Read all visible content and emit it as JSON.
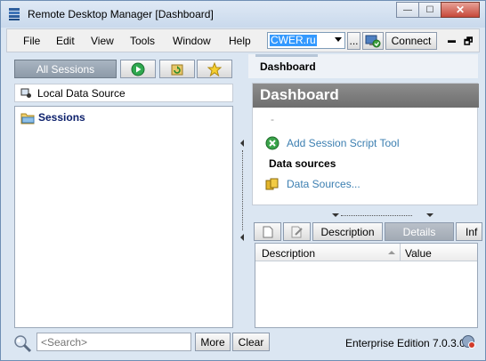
{
  "window": {
    "title": "Remote Desktop Manager [Dashboard]"
  },
  "window_controls": {
    "minimize": "—",
    "maximize": "☐",
    "close": "✕"
  },
  "menu": {
    "items": [
      "File",
      "Edit",
      "View",
      "Tools",
      "Window",
      "Help"
    ],
    "url_value": "CWER.ru",
    "more_label": "...",
    "connect_label": "Connect",
    "pin_glyph": "▬",
    "restore_glyph": "🗗"
  },
  "left_panel": {
    "all_sessions_label": "All Sessions",
    "data_source_label": "Local Data Source",
    "tree": [
      {
        "label": "Sessions"
      }
    ]
  },
  "right_panel": {
    "tab_label": "Dashboard",
    "dashboard": {
      "title": "Dashboard",
      "dash_text": "-",
      "add_tool_link": "Add Session Script Tool",
      "data_sources_heading": "Data sources",
      "data_sources_link": "Data Sources..."
    },
    "detail_tabs": [
      "Description",
      "Details",
      "Inf"
    ],
    "active_detail_tab": "Details",
    "grid_columns": [
      "Description",
      "Value"
    ]
  },
  "bottom": {
    "search_placeholder": "<Search>",
    "more_label": "More",
    "clear_label": "Clear",
    "edition": "Enterprise Edition 7.0.3.0"
  },
  "colors": {
    "window_bg": "#dbe6f2",
    "dashboard_header": "#7e7e7e",
    "link": "#3c7fb1",
    "tree_label": "#0b1f6b",
    "selection": "#3399ff"
  }
}
